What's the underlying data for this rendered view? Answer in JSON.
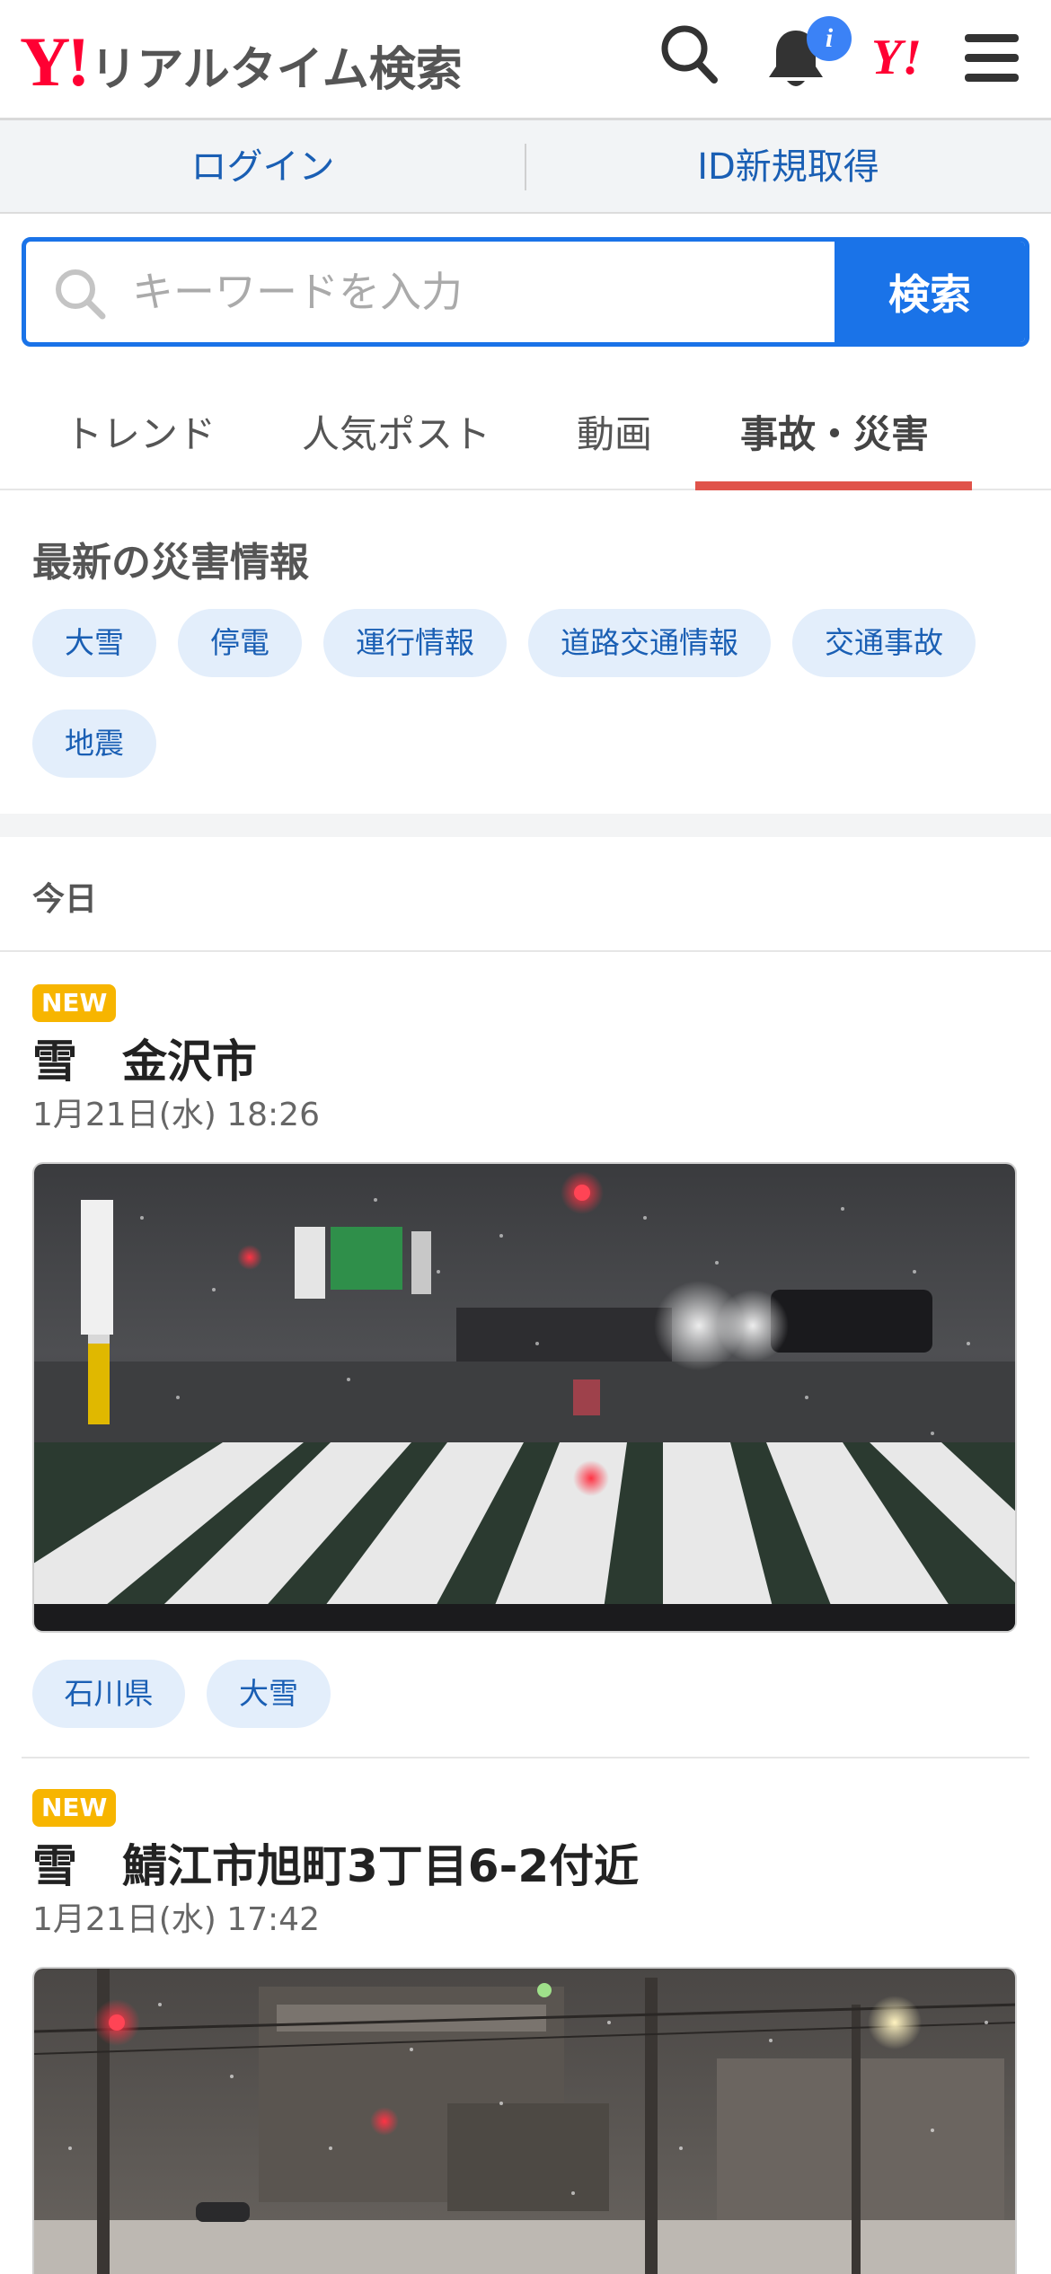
{
  "header": {
    "logo_mark": "Y!",
    "logo_text": "リアルタイム検索",
    "notification_badge": "i",
    "yahoo_small_logo": "Y!",
    "icons": [
      "search-icon",
      "bell-icon",
      "menu-icon"
    ]
  },
  "loginbar": {
    "login": "ログイン",
    "register": "ID新規取得"
  },
  "search": {
    "placeholder": "キーワードを入力",
    "button": "検索"
  },
  "tabs": [
    {
      "label": "トレンド",
      "active": false
    },
    {
      "label": "人気ポスト",
      "active": false
    },
    {
      "label": "動画",
      "active": false
    },
    {
      "label": "事故・災害",
      "active": true
    }
  ],
  "disaster": {
    "title": "最新の災害情報",
    "chips": [
      "大雪",
      "停電",
      "運行情報",
      "道路交通情報",
      "交通事故",
      "地震"
    ]
  },
  "today_label": "今日",
  "posts": [
    {
      "badge": "NEW",
      "title": "雪　金沢市",
      "time": "1月21日(水) 18:26",
      "tags": [
        "石川県",
        "大雪"
      ]
    },
    {
      "badge": "NEW",
      "title": "雪　鯖江市旭町3丁目6-2付近",
      "time": "1月21日(水) 17:42"
    }
  ],
  "colors": {
    "accent_blue": "#1a73e8",
    "link_blue": "#1a5fb4",
    "tab_underline": "#e0534a",
    "new_badge": "#f7b500",
    "brand_red": "#ff0033"
  }
}
